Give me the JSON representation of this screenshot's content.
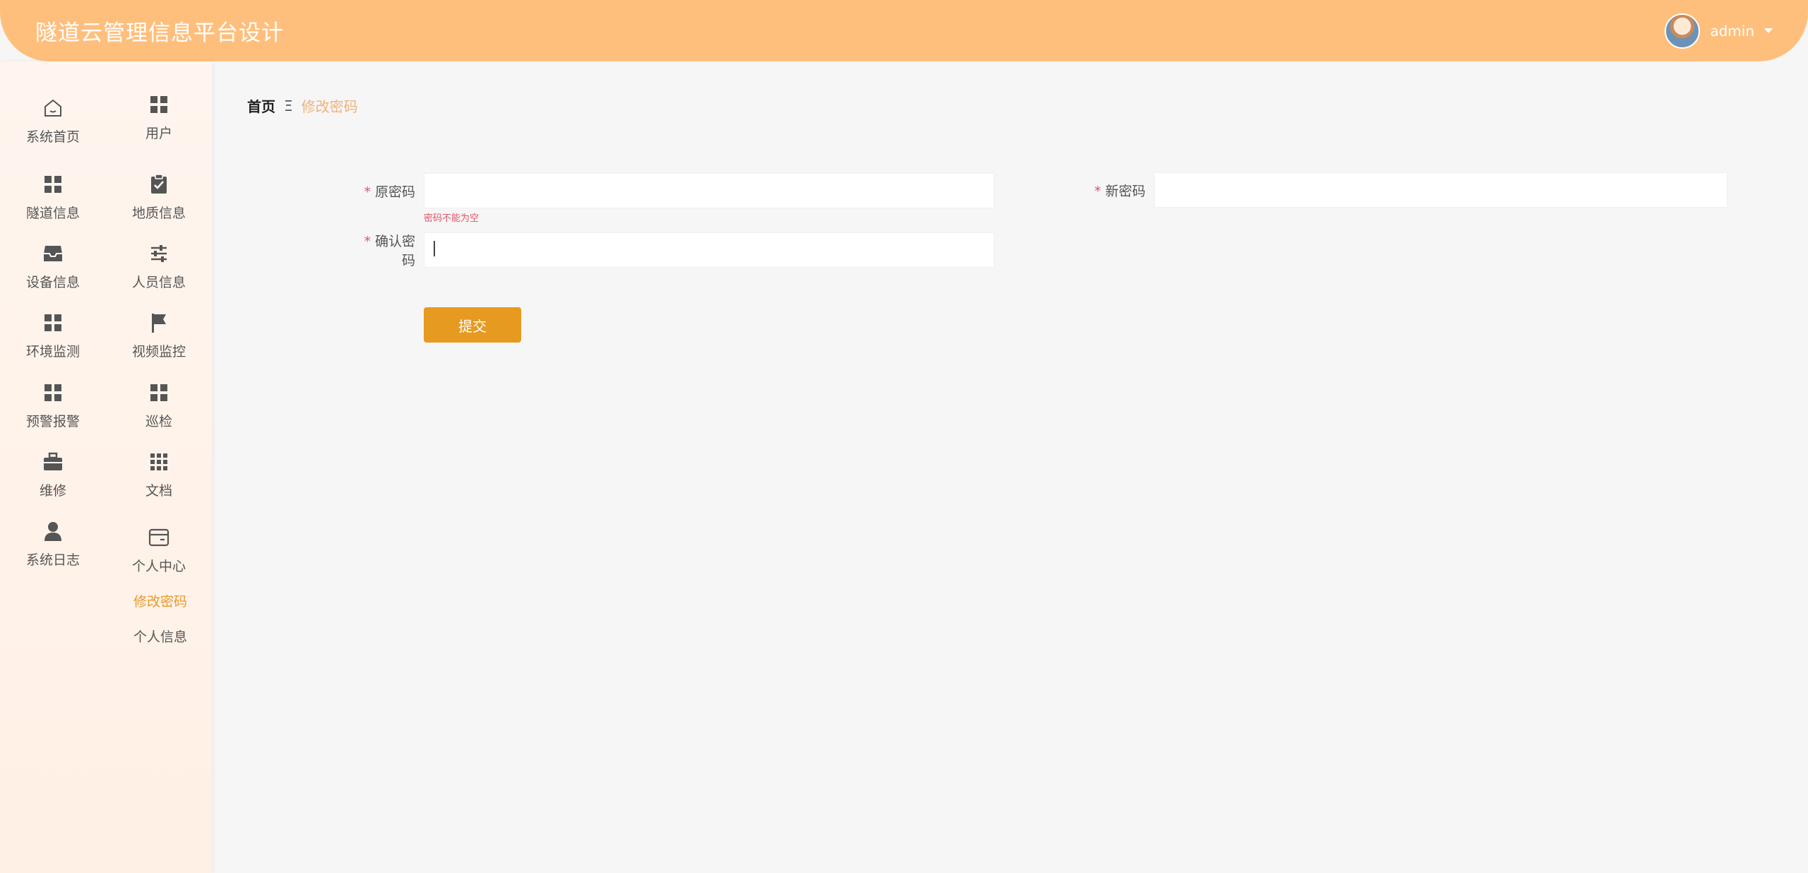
{
  "header": {
    "title": "隧道云管理信息平台设计",
    "username": "admin"
  },
  "sidebar": {
    "items": [
      {
        "label": "系统首页",
        "icon": "home-icon"
      },
      {
        "label": "用户",
        "icon": "grid-icon"
      },
      {
        "label": "隧道信息",
        "icon": "grid-icon"
      },
      {
        "label": "地质信息",
        "icon": "clipboard-check-icon"
      },
      {
        "label": "设备信息",
        "icon": "inbox-icon"
      },
      {
        "label": "人员信息",
        "icon": "sliders-icon"
      },
      {
        "label": "环境监测",
        "icon": "grid-icon"
      },
      {
        "label": "视频监控",
        "icon": "flag-icon"
      },
      {
        "label": "预警报警",
        "icon": "grid-icon"
      },
      {
        "label": "巡检",
        "icon": "grid-icon"
      },
      {
        "label": "维修",
        "icon": "briefcase-icon"
      },
      {
        "label": "文档",
        "icon": "apps-icon"
      },
      {
        "label": "系统日志",
        "icon": "user-icon"
      },
      {
        "label": "个人中心",
        "icon": "wallet-icon"
      }
    ],
    "sub_items": [
      {
        "label": "修改密码",
        "active": true
      },
      {
        "label": "个人信息",
        "active": false
      }
    ]
  },
  "breadcrumb": {
    "home": "首页",
    "separator": "Ξ",
    "current": "修改密码"
  },
  "form": {
    "old_password": {
      "label": "原密码",
      "value": "",
      "error": "密码不能为空"
    },
    "new_password": {
      "label": "新密码",
      "value": ""
    },
    "confirm_password": {
      "label": "确认密码",
      "value": ""
    },
    "required_mark": "*",
    "submit_label": "提交"
  },
  "colors": {
    "header": "#ffbf7c",
    "accent": "#e69a1f",
    "error": "#e0536b",
    "breadcrumb_active": "#f0b27a"
  }
}
